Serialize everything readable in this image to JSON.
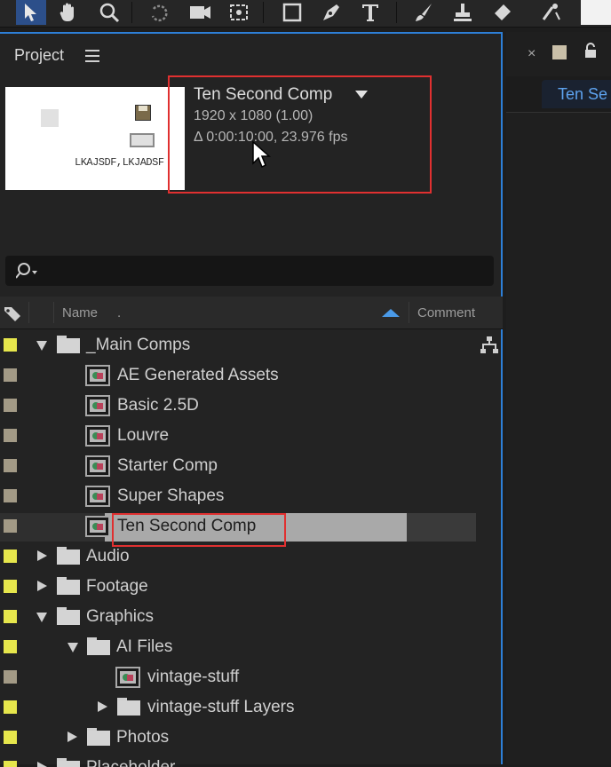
{
  "toolbar": {
    "tools": [
      "selection-tool-icon",
      "hand-tool-icon",
      "zoom-tool-icon",
      "rotate-tool-icon",
      "camera-tool-icon",
      "pan-behind-tool-icon",
      "rectangle-tool-icon",
      "pen-tool-icon",
      "type-tool-icon",
      "brush-tool-icon",
      "clone-stamp-tool-icon",
      "eraser-tool-icon",
      "puppet-pin-tool-icon"
    ],
    "active_color": "#2c4f8a"
  },
  "project_panel": {
    "title": "Project",
    "thumbnail_text": "LKAJSDF,LKJADSF",
    "comp_name": "Ten Second Comp",
    "resolution": "1920 x 1080 (1.00)",
    "duration": "Δ 0:00:10:00, 23.976 fps",
    "columns": {
      "name": "Name",
      "name_dot": ".",
      "comment": "Comment"
    },
    "items": [
      {
        "label": "_Main Comps",
        "type": "folder",
        "expanded": true,
        "color": "#e6e64c"
      },
      {
        "label": "AE Generated Assets",
        "type": "comp",
        "color": "#a39a86"
      },
      {
        "label": "Basic 2.5D",
        "type": "comp",
        "color": "#a39a86"
      },
      {
        "label": "Louvre",
        "type": "comp",
        "color": "#a39a86"
      },
      {
        "label": "Starter Comp",
        "type": "comp",
        "color": "#a39a86"
      },
      {
        "label": "Super Shapes",
        "type": "comp",
        "color": "#a39a86"
      },
      {
        "label": "Ten Second Comp",
        "type": "comp",
        "selected": true,
        "color": "#a39a86"
      },
      {
        "label": "Audio",
        "type": "folder",
        "expanded": false,
        "color": "#e6e64c"
      },
      {
        "label": "Footage",
        "type": "folder",
        "expanded": false,
        "color": "#e6e64c"
      },
      {
        "label": "Graphics",
        "type": "folder",
        "expanded": true,
        "color": "#e6e64c"
      },
      {
        "label": "AI Files",
        "type": "folder",
        "expanded": true,
        "color": "#e6e64c"
      },
      {
        "label": "vintage-stuff",
        "type": "comp",
        "color": "#a39a86"
      },
      {
        "label": "vintage-stuff Layers",
        "type": "folder",
        "expanded": false,
        "color": "#e6e64c"
      },
      {
        "label": "Photos",
        "type": "folder",
        "expanded": false,
        "color": "#e6e64c"
      },
      {
        "label": "Placeholder",
        "type": "folder",
        "expanded": false,
        "color": "#e6e64c"
      }
    ]
  },
  "right_panel": {
    "close": "×",
    "tab_label": "Ten Se"
  },
  "colors": {
    "accent": "#2d7fd7",
    "highlight_box": "#e03030",
    "selection": "#a9a9a9"
  }
}
